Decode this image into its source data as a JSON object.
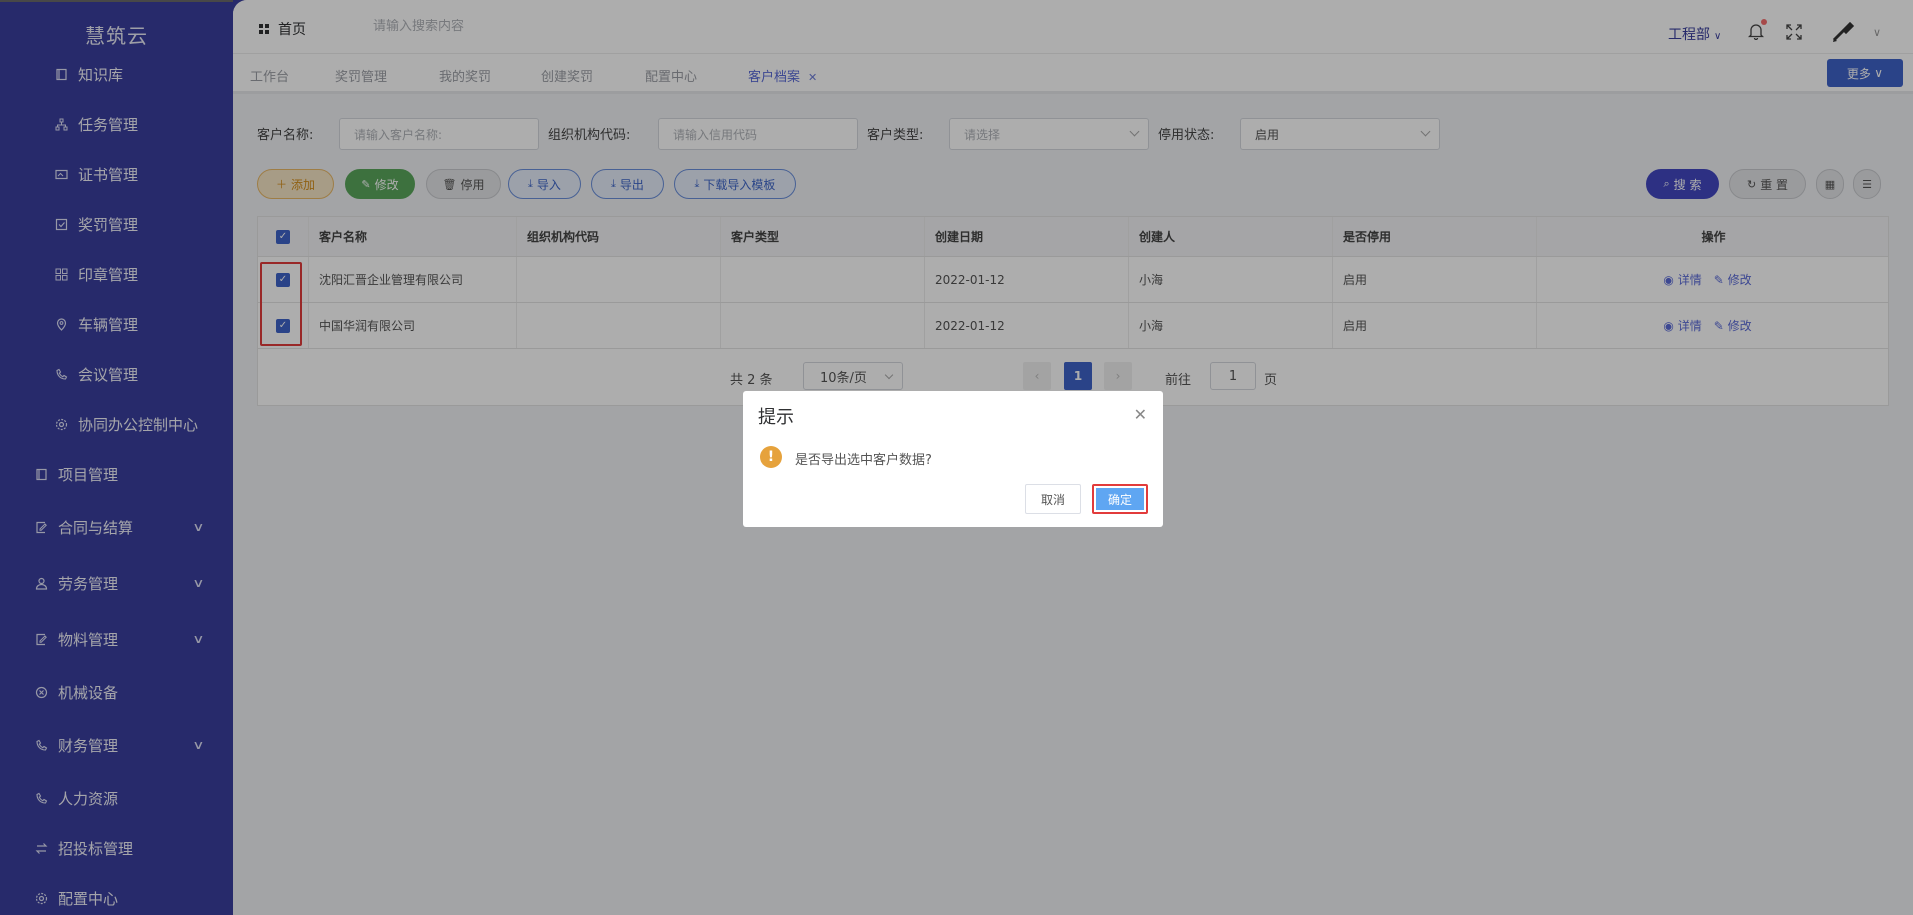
{
  "sidebar": {
    "logo": "慧筑云",
    "items": [
      {
        "label": "知识库",
        "icon": "book-icon",
        "level": "sub"
      },
      {
        "label": "任务管理",
        "icon": "org-icon",
        "level": "sub"
      },
      {
        "label": "证书管理",
        "icon": "certificate-icon",
        "level": "sub"
      },
      {
        "label": "奖罚管理",
        "icon": "check-square-icon",
        "level": "sub"
      },
      {
        "label": "印章管理",
        "icon": "grid-icon",
        "level": "sub"
      },
      {
        "label": "车辆管理",
        "icon": "location-icon",
        "level": "sub"
      },
      {
        "label": "会议管理",
        "icon": "phone-icon",
        "level": "sub"
      },
      {
        "label": "协同办公控制中心",
        "icon": "gear-icon",
        "level": "sub"
      },
      {
        "label": "项目管理",
        "icon": "book-icon",
        "level": "top"
      },
      {
        "label": "合同与结算",
        "icon": "edit-doc-icon",
        "level": "top",
        "expandable": true
      },
      {
        "label": "劳务管理",
        "icon": "user-icon",
        "level": "top",
        "expandable": true
      },
      {
        "label": "物料管理",
        "icon": "edit-doc-icon",
        "level": "top",
        "expandable": true
      },
      {
        "label": "机械设备",
        "icon": "circle-x-icon",
        "level": "top"
      },
      {
        "label": "财务管理",
        "icon": "phone-icon",
        "level": "top",
        "expandable": true
      },
      {
        "label": "人力资源",
        "icon": "phone-icon",
        "level": "top"
      },
      {
        "label": "招投标管理",
        "icon": "swap-icon",
        "level": "top"
      },
      {
        "label": "配置中心",
        "icon": "gear-icon",
        "level": "top"
      }
    ]
  },
  "header": {
    "home_label": "首页",
    "search_placeholder": "请输入搜索内容",
    "department": "工程部"
  },
  "tabs": [
    {
      "label": "工作台",
      "active": false
    },
    {
      "label": "奖罚管理",
      "active": false
    },
    {
      "label": "我的奖罚",
      "active": false
    },
    {
      "label": "创建奖罚",
      "active": false
    },
    {
      "label": "配置中心",
      "active": false
    },
    {
      "label": "客户档案",
      "active": true
    }
  ],
  "more_label": "更多",
  "filters": {
    "name_label": "客户名称:",
    "name_placeholder": "请输入客户名称:",
    "code_label": "组织机构代码:",
    "code_placeholder": "请输入信用代码",
    "type_label": "客户类型:",
    "type_placeholder": "请选择",
    "status_label": "停用状态:",
    "status_value": "启用"
  },
  "toolbar": {
    "add": "添加",
    "edit": "修改",
    "disable": "停用",
    "import": "导入",
    "export": "导出",
    "download_template": "下载导入模板",
    "search": "搜 索",
    "reset": "重 置"
  },
  "table": {
    "columns": [
      "客户名称",
      "组织机构代码",
      "客户类型",
      "创建日期",
      "创建人",
      "是否停用",
      "操作"
    ],
    "rows": [
      {
        "checked": true,
        "name": "沈阳汇晋企业管理有限公司",
        "code": "",
        "type": "",
        "date": "2022-01-12",
        "creator": "小海",
        "status": "启用"
      },
      {
        "checked": true,
        "name": "中国华润有限公司",
        "code": "",
        "type": "",
        "date": "2022-01-12",
        "creator": "小海",
        "status": "启用"
      }
    ],
    "op_detail": "详情",
    "op_edit": "修改"
  },
  "pagination": {
    "total": "共 2 条",
    "page_size": "10条/页",
    "current": "1",
    "goto_prefix": "前往",
    "goto_value": "1",
    "goto_suffix": "页"
  },
  "dialog": {
    "title": "提示",
    "message": "是否导出选中客户数据?",
    "cancel": "取消",
    "confirm": "确定"
  }
}
